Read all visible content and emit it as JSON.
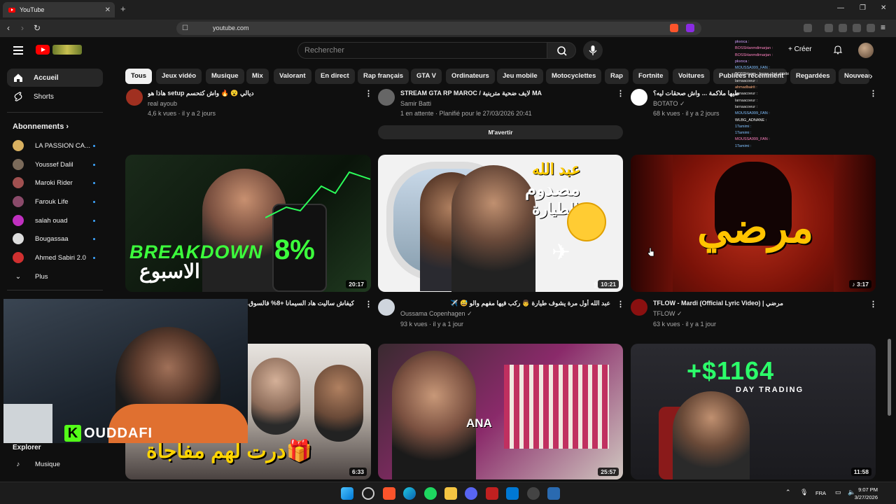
{
  "browser": {
    "tab_title": "YouTube",
    "tab_close": "✕",
    "new_tab": "+",
    "url": "youtube.com",
    "win_min": "—",
    "win_max": "❐",
    "win_close": "✕"
  },
  "header": {
    "search_placeholder": "Rechercher",
    "create_label": "+ Créer"
  },
  "chips": [
    "Tous",
    "Jeux vidéo",
    "Musique",
    "Mix",
    "Valorant",
    "En direct",
    "Rap français",
    "GTA V",
    "Ordinateurs",
    "Jeu mobile",
    "Motocyclettes",
    "Rap",
    "Fortnite",
    "Voitures",
    "Publiées récemment",
    "Regardées",
    "Nouveau"
  ],
  "sidebar": {
    "home": "Accueil",
    "shorts": "Shorts",
    "subs_heading": "Abonnements",
    "subs": [
      "LA PASSION CA...",
      "Youssef Dalil",
      "Maroki Rider",
      "Farouk Life",
      "salah ouad",
      "Bougassaa",
      "Ahmed Sabiri 2.0"
    ],
    "more": "Plus",
    "explore": "Explorer",
    "music": "Musique"
  },
  "top_row": [
    {
      "title": "هاذا هو setup ديالي 😮 🔥 واش كتحسم",
      "channel": "real ayoub",
      "meta": "4,6 k vues · il y a 2 jours"
    },
    {
      "title": "STREAM GTA RP MAROC / لايف ضحية مترينية MA",
      "channel": "Samir Batti",
      "meta": "1 en attente · Planifié pour le 27/03/2026 20:41",
      "button": "M'avertir"
    },
    {
      "title": "طيها ملاكمة ... واش صحقات ليه؟",
      "channel": "BOTATO ✓",
      "meta": "68 k vues · il y a 2 jours"
    }
  ],
  "mid_row": [
    {
      "title": "كيفاش ساليت هاد السيمانا +8% فالسوق...",
      "thumb_text_1": "BREAKDOWN",
      "thumb_text_2": "الاسبوع",
      "thumb_pct": "8%",
      "duration": "20:17"
    },
    {
      "title": "عبد الله أول مرة يشوف طيارة 👨 ركب فيها مفهم والو 😅 ✈️",
      "channel": "Oussama Copenhagen ✓",
      "meta": "93 k vues · il y a 1 jour",
      "thumb_text_1": "عبد الله",
      "thumb_text_2": "مصدوم",
      "thumb_text_3": "الطيارة!!",
      "duration": "10:21"
    },
    {
      "title": "TFLOW - Mardi (Official Lyric Video) | مرضي",
      "channel": "TFLOW ✓",
      "meta": "63 k vues · il y a 1 jour",
      "thumb_text": "مرضي",
      "duration": "3:17"
    }
  ],
  "bottom_row": [
    {
      "thumb_text": "درت لهم مفاجأة🎁",
      "duration": "6:33"
    },
    {
      "thumb_text": "ANA",
      "duration": "25:57"
    },
    {
      "thumb_text_1": "+$1164",
      "thumb_text_2": "DAY TRADING",
      "duration": "11:58"
    }
  ],
  "webcam": {
    "badge": "K",
    "name": "OUDDAFI"
  },
  "chat": [
    "pkvoca :",
    "BOSSHanmdimarjan :",
    "BOSSHanmdimarjan :",
    "pkvoca :",
    "MOUSSA999_FAN :",
    "BOSSHanm : ferme chat ahbibi",
    "larnaacoeur :",
    "ahmadbairit :",
    "larnaacoeur :",
    "larnaacoeur :",
    "larnaacoeur :",
    "MOUSSA999_FAN :",
    "WLBG_ADNANE :",
    "1Tamimi :",
    "1Tamimi :",
    "MOUSSA999_FAN :",
    "1Tamimi :"
  ],
  "taskbar": {
    "lang": "FRA",
    "time": "9:07 PM",
    "date": "3/27/2026"
  }
}
